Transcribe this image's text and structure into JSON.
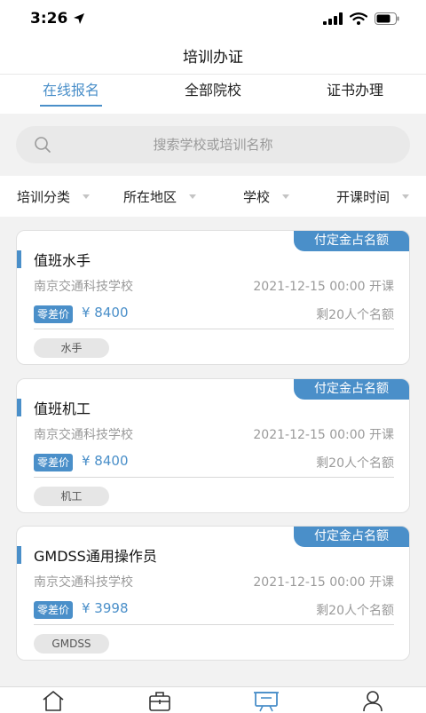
{
  "status_bar": {
    "time": "3:26",
    "icons": [
      "location-arrow-icon",
      "signal-icon",
      "wifi-icon",
      "battery-icon"
    ]
  },
  "header": {
    "title": "培训办证"
  },
  "tabs": [
    {
      "label": "在线报名",
      "active": true
    },
    {
      "label": "全部院校",
      "active": false
    },
    {
      "label": "证书办理",
      "active": false
    }
  ],
  "search": {
    "placeholder": "搜索学校或培训名称",
    "value": "",
    "icon": "search-icon"
  },
  "filters": [
    {
      "label": "培训分类"
    },
    {
      "label": "所在地区"
    },
    {
      "label": "学校"
    },
    {
      "label": "开课时间"
    }
  ],
  "courses": [
    {
      "badge": "付定金占名额",
      "title": "值班水手",
      "school": "南京交通科技学校",
      "date": "2021-12-15 00:00 开课",
      "price_label": "零差价",
      "price": "¥ 8400",
      "seats": "剩20人个名额",
      "tag": "水手"
    },
    {
      "badge": "付定金占名额",
      "title": "值班机工",
      "school": "南京交通科技学校",
      "date": "2021-12-15 00:00 开课",
      "price_label": "零差价",
      "price": "¥ 8400",
      "seats": "剩20人个名额",
      "tag": "机工"
    },
    {
      "badge": "付定金占名额",
      "title": "GMDSS通用操作员",
      "school": "南京交通科技学校",
      "date": "2021-12-15 00:00 开课",
      "price_label": "零差价",
      "price": "¥ 3998",
      "seats": "剩20人个名额",
      "tag": "GMDSS"
    }
  ],
  "bottom_nav": [
    {
      "icon": "home-icon",
      "active": false
    },
    {
      "icon": "briefcase-icon",
      "active": false
    },
    {
      "icon": "training-board-icon",
      "active": true
    },
    {
      "icon": "user-icon",
      "active": false
    }
  ],
  "colors": {
    "accent": "#4a8fc9",
    "muted_text": "#9a9a9a",
    "background": "#f2f2f2"
  }
}
